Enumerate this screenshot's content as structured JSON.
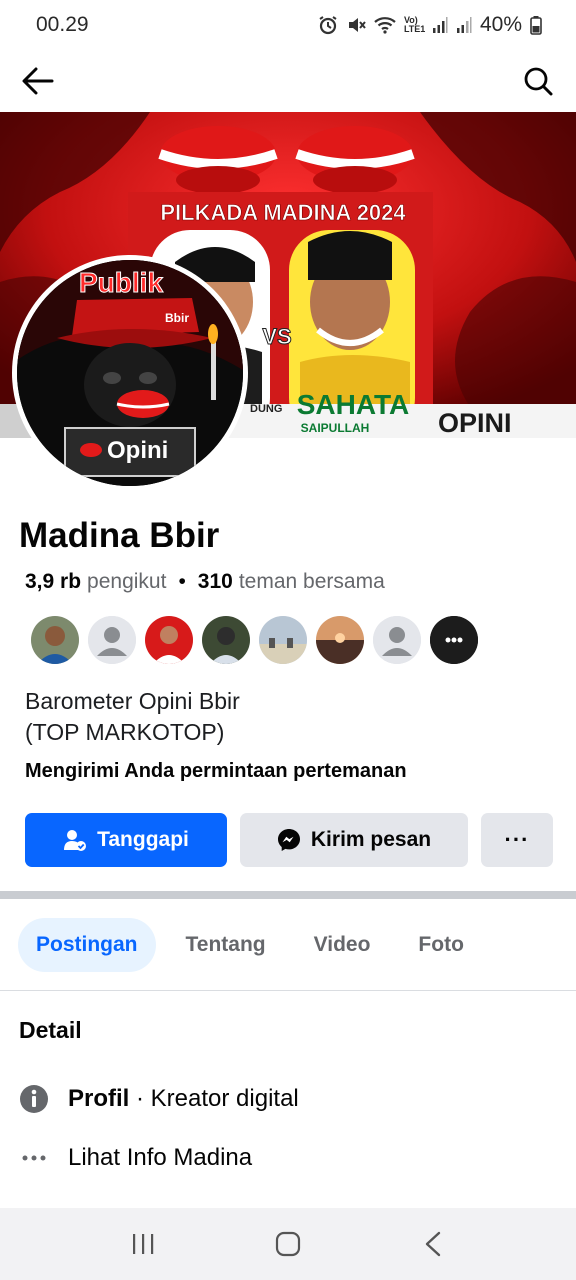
{
  "status_bar": {
    "time": "00.29",
    "battery": "40%",
    "network_label": "Vo) LTE1"
  },
  "profile": {
    "name": "Madina Bbir",
    "followers_count": "3,9 rb",
    "followers_label": "pengikut",
    "mutual_count": "310",
    "mutual_label": "teman bersama",
    "bio_line1": "Barometer Opini Bbir",
    "bio_line2": "(TOP MARKOTOP)",
    "request_text": "Mengirimi Anda permintaan pertemanan"
  },
  "cover": {
    "headline": "PILKADA MADINA 2024",
    "versus": "VS",
    "candidate_left_fragment": "DUNG",
    "candidate_left_partial": "N",
    "candidate_right_name": "SAHATA",
    "candidate_right_subname": "SAIPULLAH",
    "banner_word": "OPINI"
  },
  "avatar": {
    "title": "Publik",
    "sub": "Bbir",
    "logo_word": "Opini"
  },
  "actions": {
    "respond_label": "Tanggapi",
    "message_label": "Kirim pesan",
    "more_label": "···"
  },
  "tabs": [
    {
      "label": "Postingan"
    },
    {
      "label": "Tentang"
    },
    {
      "label": "Video"
    },
    {
      "label": "Foto"
    }
  ],
  "details": {
    "title": "Detail",
    "profile_bold": "Profil",
    "profile_value": " · Kreator digital",
    "see_info": "Lihat Info Madina"
  },
  "colors": {
    "primary": "#0866ff",
    "secondary_bg": "#e4e6eb",
    "active_tab_bg": "#e7f3ff",
    "muted_text": "#65676b"
  }
}
